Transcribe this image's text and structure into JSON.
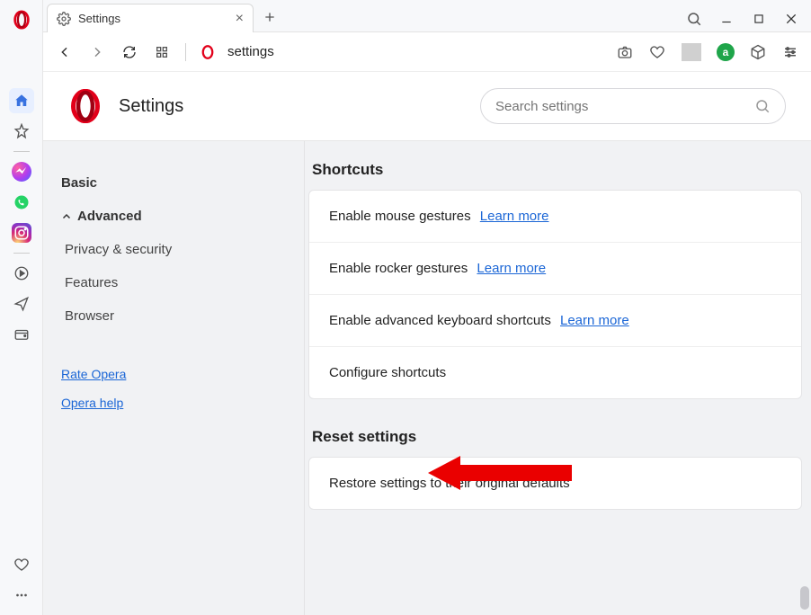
{
  "tab": {
    "title": "Settings"
  },
  "address": {
    "value": "settings"
  },
  "header": {
    "title": "Settings"
  },
  "search": {
    "placeholder": "Search settings"
  },
  "nav": {
    "basic": "Basic",
    "advanced": "Advanced",
    "privacy": "Privacy & security",
    "features": "Features",
    "browser": "Browser",
    "rate": "Rate Opera",
    "help": "Opera help"
  },
  "sections": {
    "shortcuts": "Shortcuts",
    "reset": "Reset settings"
  },
  "rows": {
    "mouse_gestures": "Enable mouse gestures",
    "rocker_gestures": "Enable rocker gestures",
    "keyboard_shortcuts": "Enable advanced keyboard shortcuts",
    "configure": "Configure shortcuts",
    "restore": "Restore settings to their original defaults",
    "learn_more": "Learn more"
  }
}
